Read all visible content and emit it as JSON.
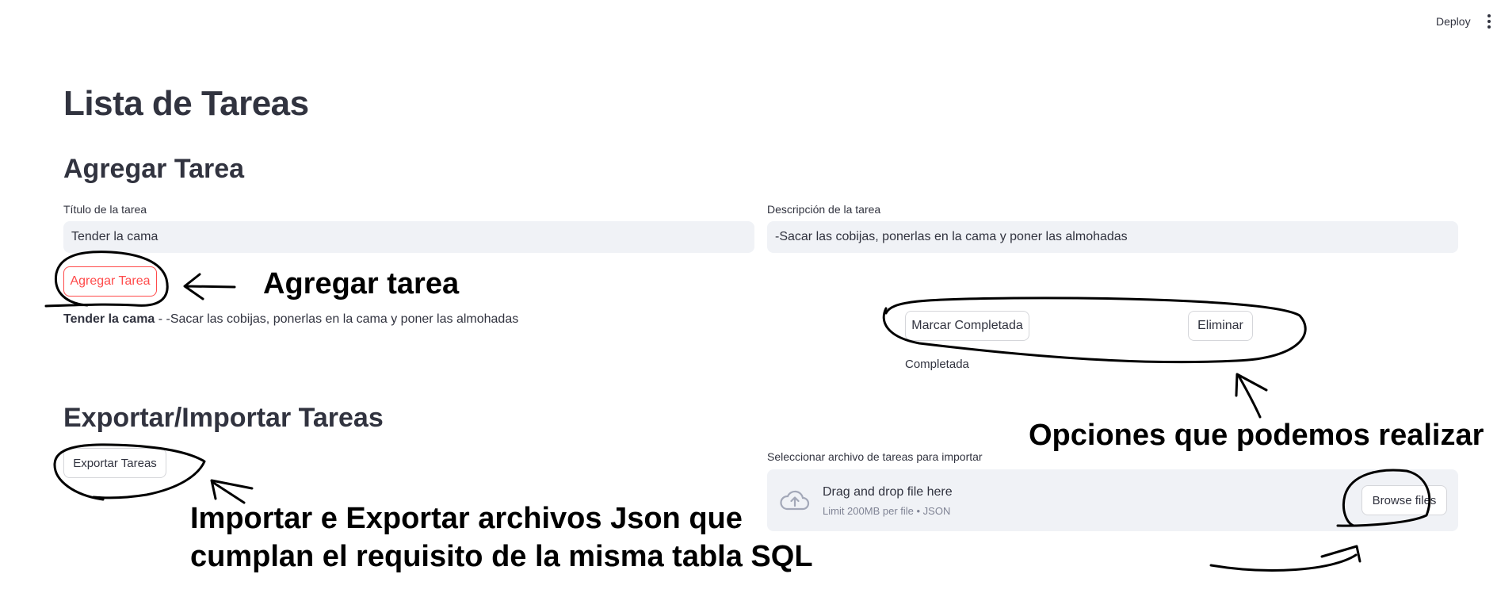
{
  "header": {
    "deploy_label": "Deploy"
  },
  "page": {
    "title": "Lista de Tareas"
  },
  "add_section": {
    "heading": "Agregar Tarea",
    "title_label": "Título de la tarea",
    "title_value": "Tender la cama",
    "desc_label": "Descripción de la tarea",
    "desc_value": "-Sacar las cobijas, ponerlas en la cama y poner las almohadas",
    "add_button": "Agregar Tarea"
  },
  "task": {
    "title": "Tender la cama",
    "separator": " - ",
    "description": "-Sacar las cobijas, ponerlas en la cama y poner las almohadas",
    "complete_button": "Marcar Completada",
    "delete_button": "Eliminar",
    "status": "Completada"
  },
  "io_section": {
    "heading": "Exportar/Importar Tareas",
    "export_button": "Exportar Tareas",
    "import_label": "Seleccionar archivo de tareas para importar",
    "dropzone_text": "Drag and drop file here",
    "dropzone_limit": "Limit 200MB per file • JSON",
    "browse_button": "Browse files"
  },
  "annotations": {
    "add": "Agregar tarea",
    "options": "Opciones que podemos realizar",
    "json_line1": "Importar e Exportar archivos Json que",
    "json_line2": "cumplan el requisito de la misma tabla SQL"
  },
  "icons": {
    "menu": "kebab-menu-icon",
    "upload": "cloud-upload-icon"
  },
  "colors": {
    "accent": "#ff4b4b",
    "input_bg": "#f0f2f6",
    "text": "#31333f"
  }
}
